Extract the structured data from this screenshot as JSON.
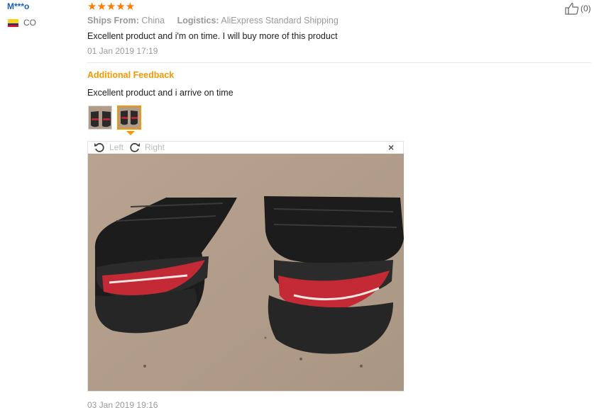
{
  "reviewer": {
    "name": "M***o",
    "country": "CO",
    "flag_icon": "colombia-flag-icon"
  },
  "rating": {
    "stars": "★★★★★",
    "value": 5,
    "max": 5,
    "color": "#ff7a00"
  },
  "meta": {
    "ships_from_label": "Ships From:",
    "ships_from_value": "China",
    "logistics_label": "Logistics:",
    "logistics_value": "AliExpress Standard Shipping"
  },
  "review": {
    "text": "Excellent product and i'm on time. I will buy more of this product",
    "date": "01 Jan 2019 17:19"
  },
  "additional": {
    "title": "Additional Feedback",
    "text": "Excellent product and i arrive on time",
    "date": "03 Jan 2019 19:16"
  },
  "viewer": {
    "rotate_left_label": "Left",
    "rotate_right_label": "Right",
    "close_label": "×"
  },
  "helpful": {
    "count_label": "(0)",
    "icon": "thumbs-up-icon"
  },
  "colors": {
    "accent": "#f39800",
    "username": "#1a5fb4",
    "muted": "#999999"
  }
}
